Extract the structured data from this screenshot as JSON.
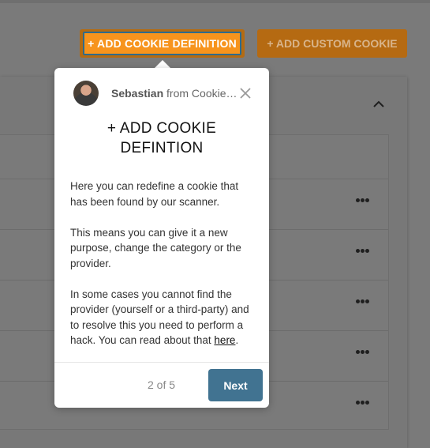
{
  "toolbar": {
    "add_cookie_definition": "+ ADD COOKIE DEFINITION",
    "add_custom_cookie": "+ ADD CUSTOM COOKIE"
  },
  "popover": {
    "sender_name": "Sebastian",
    "sender_from": "from Cookie I...",
    "title_line1": "+ ADD COOKIE",
    "title_line2": "DEFINTION",
    "paragraph1": "Here you can redefine a cookie that has been found by our scanner.",
    "paragraph2": "This means you can give it a new purpose, change the category or the provider.",
    "paragraph3": "In some cases you cannot find the provider (yourself or a third-party) and to resolve this you need to perform a hack. You can read about that",
    "link_text": "here",
    "link_suffix": ".",
    "step": "2 of 5",
    "next_label": "Next"
  },
  "colors": {
    "accent_orange": "#f7941d",
    "next_button": "#417391",
    "overlay": "#7a7a7a"
  },
  "icons": [
    "close-icon",
    "chevron-up-icon",
    "more-options-icon"
  ]
}
